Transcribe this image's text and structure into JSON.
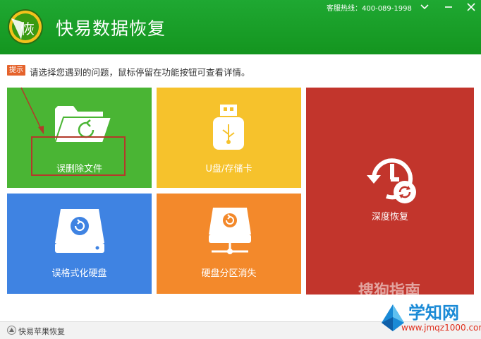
{
  "titlebar": {
    "logo_char": "恢",
    "app_title": "快易数据恢复",
    "hotline": "客服热线：400-089-1998",
    "bg_color": "#14951f"
  },
  "tip": {
    "badge": "提示",
    "text": "请选择您遇到的问题，鼠标停留在功能按钮可查看详情。"
  },
  "tiles": {
    "delete": {
      "label": "误删除文件",
      "color": "#4ab534",
      "icon": "folder-restore-icon"
    },
    "udisk": {
      "label": "U盘/存储卡",
      "color": "#f6c22c",
      "icon": "usb-drive-icon"
    },
    "deep": {
      "label": "深度恢复",
      "color": "#c2352c",
      "icon": "history-clock-icon"
    },
    "format": {
      "label": "误格式化硬盘",
      "color": "#3f83e2",
      "icon": "hard-disk-icon"
    },
    "partition": {
      "label": "硬盘分区消失",
      "color": "#f3892b",
      "icon": "network-disk-icon"
    }
  },
  "bottom": {
    "apple_label": "快易苹果恢复"
  },
  "watermarks": {
    "sogou": "搜狗指南",
    "xzw_title": "学知网",
    "xzw_url": "www.jmqz1000.com"
  }
}
